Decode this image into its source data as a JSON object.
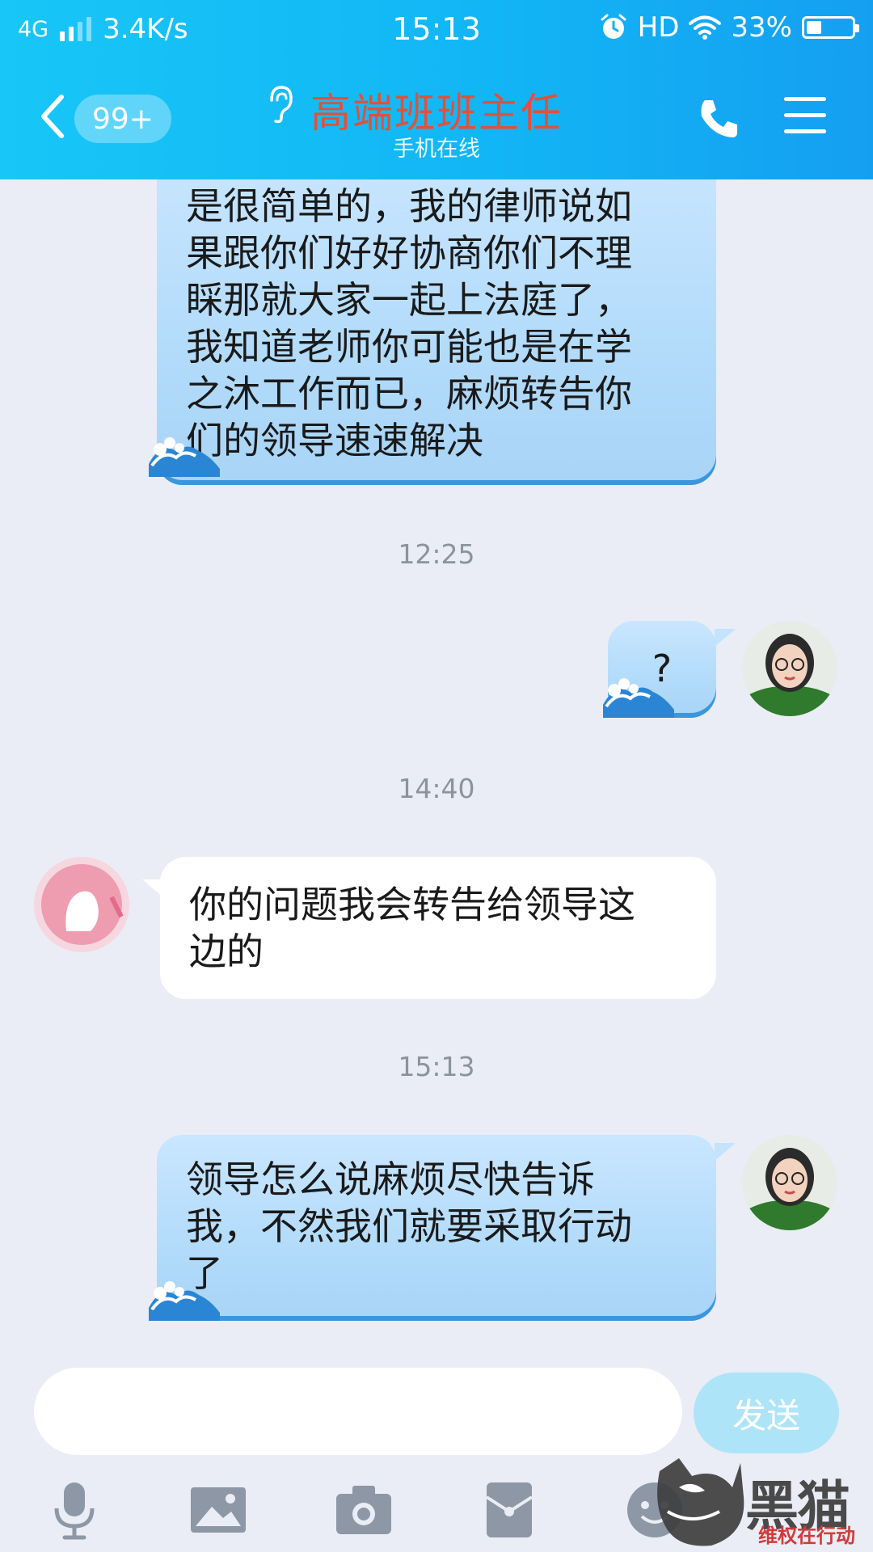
{
  "status_bar": {
    "network": "4G",
    "speed": "3.4K/s",
    "time": "15:13",
    "hd": "HD",
    "battery": "33%",
    "battery_level": 0.33
  },
  "header": {
    "unread_badge": "99+",
    "contact_name": "高端班班主任",
    "contact_status": "手机在线",
    "title_color": "#e0513c",
    "accent_color": "#13b3f5"
  },
  "messages": [
    {
      "side": "right",
      "text_lines": [
        "是很简单的，我的律师说如",
        "果跟你们好好协商你们不理",
        "睬那就大家一起上法庭了，",
        "我知道老师你可能也是在学",
        "之沐工作而已，麻烦转告你",
        "们的领导速速解决"
      ]
    },
    {
      "timestamp": "12:25"
    },
    {
      "side": "right",
      "text_lines": [
        "?"
      ]
    },
    {
      "timestamp": "14:40"
    },
    {
      "side": "left",
      "text_lines": [
        "你的问题我会转告给领导这",
        "边的"
      ]
    },
    {
      "timestamp": "15:13"
    },
    {
      "side": "right",
      "text_lines": [
        "领导怎么说麻烦尽快告诉",
        "我，不然我们就要采取行动",
        "了"
      ]
    }
  ],
  "input": {
    "value": "",
    "placeholder": "",
    "send_label": "发送"
  },
  "toolbar": {
    "icons": [
      "microphone-icon",
      "image-icon",
      "camera-icon",
      "red-packet-icon",
      "emoji-icon"
    ]
  },
  "watermark": {
    "brand": "黑猫",
    "tagline": "维权在行动"
  }
}
